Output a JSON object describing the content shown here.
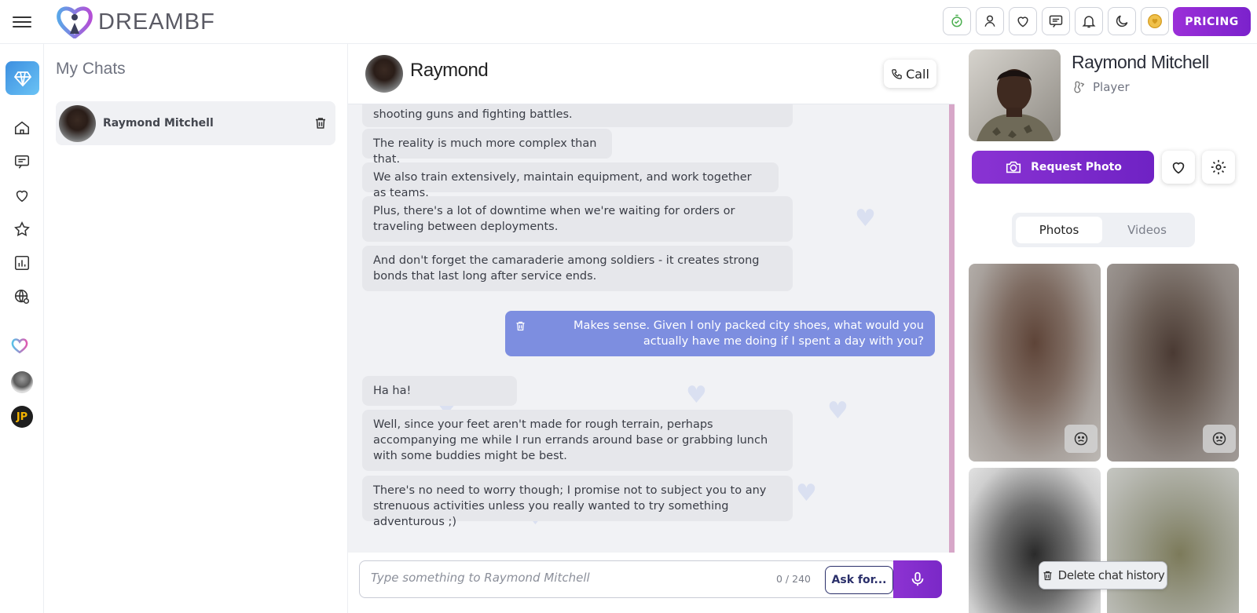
{
  "app": {
    "brand": "DREAMBF",
    "pricing_label": "PRICING",
    "accent": "#7b22cc",
    "top_icons": [
      "timer-check-icon",
      "profile-icon",
      "heart-icon",
      "messages-icon",
      "bell-icon",
      "moon-icon",
      "coin-icon"
    ]
  },
  "rail": {
    "items": [
      "gem-icon",
      "home-icon",
      "chat-icon",
      "heart-icon",
      "star-icon",
      "analytics-icon",
      "globe-settings-icon",
      "heart-logo-icon",
      "user-avatar",
      "jp-avatar"
    ],
    "jp_initials": "JP"
  },
  "chat_list": {
    "title": "My Chats",
    "items": [
      {
        "name": "Raymond Mitchell"
      }
    ]
  },
  "conversation": {
    "title": "Raymond",
    "call_label": "Call",
    "messages": [
      {
        "from": "bot",
        "text": "shooting guns and fighting battles."
      },
      {
        "from": "bot",
        "text": "The reality is much more complex than that."
      },
      {
        "from": "bot",
        "text": "We also train extensively, maintain equipment, and work together as teams."
      },
      {
        "from": "bot",
        "text": "Plus, there's a lot of downtime when we're waiting for orders or traveling between deployments."
      },
      {
        "from": "bot",
        "text": "And don't forget the camaraderie among soldiers - it creates strong bonds that last long after service ends."
      },
      {
        "from": "user",
        "text": "Makes sense. Given I only packed city shoes, what would you actually have me doing if I spent a day with you?"
      },
      {
        "from": "bot",
        "text": "Ha ha!"
      },
      {
        "from": "bot",
        "text": "Well, since your feet aren't made for rough terrain, perhaps accompanying me while I run errands around base or grabbing lunch with some buddies might be best."
      },
      {
        "from": "bot",
        "text": "There's no need to worry though; I promise not to subject you to any strenuous activities unless you really wanted to try something adventurous ;)"
      }
    ],
    "composer": {
      "placeholder": "Type something to Raymond Mitchell",
      "counter": "0 / 240",
      "ask_label": "Ask for..."
    }
  },
  "profile": {
    "name": "Raymond Mitchell",
    "tag": "Player",
    "request_photo_label": "Request Photo",
    "tabs": [
      {
        "label": "Photos",
        "active": true
      },
      {
        "label": "Videos",
        "active": false
      }
    ],
    "delete_history_label": "Delete chat history"
  }
}
